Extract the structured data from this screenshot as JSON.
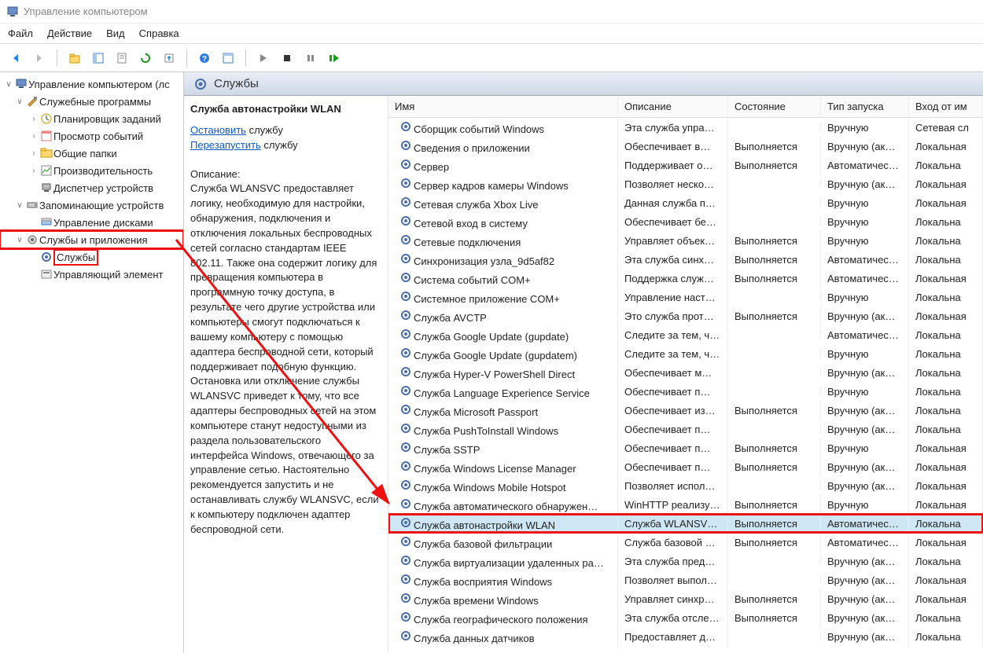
{
  "window": {
    "title": "Управление компьютером"
  },
  "menu": [
    "Файл",
    "Действие",
    "Вид",
    "Справка"
  ],
  "tree": {
    "root": "Управление компьютером (лс",
    "system_tools": "Служебные программы",
    "task_scheduler": "Планировщик заданий",
    "event_viewer": "Просмотр событий",
    "shared_folders": "Общие папки",
    "performance": "Производительность",
    "device_manager": "Диспетчер устройств",
    "storage": "Запоминающие устройств",
    "disk_mgmt": "Управление дисками",
    "services_apps": "Службы и приложения",
    "services": "Службы",
    "wmi": "Управляющий элемент"
  },
  "header": {
    "title": "Службы"
  },
  "detail": {
    "title": "Служба автонастройки WLAN",
    "stop": "Остановить",
    "restart": "Перезапустить",
    "service_suffix": " службу",
    "desc_label": "Описание:",
    "desc_text": "Служба WLANSVC предоставляет логику, необходимую для настройки, обнаружения, подключения и отключения локальных беспроводных сетей согласно стандартам IEEE 802.11. Также она содержит логику для превращения компьютера в программную точку доступа, в результате чего другие устройства или компьютеры смогут подключаться к вашему компьютеру с помощью адаптера беспроводной сети, который поддерживает подобную функцию. Остановка или отключение службы WLANSVC приведет к тому, что все адаптеры беспроводных сетей на этом компьютере станут недоступными из раздела пользовательского интерфейса Windows, отвечающего за управление сетью. Настоятельно рекомендуется запустить и не останавливать службу WLANSVC, если к компьютеру подключен адаптер беспроводной сети."
  },
  "columns": {
    "name": "Имя",
    "desc": "Описание",
    "state": "Состояние",
    "startup": "Тип запуска",
    "logon": "Вход от им"
  },
  "rows": [
    {
      "name": "Сборщик событий Windows",
      "desc": "Эта служба упра…",
      "state": "",
      "startup": "Вручную",
      "logon": "Сетевая сл"
    },
    {
      "name": "Сведения о приложении",
      "desc": "Обеспечивает в…",
      "state": "Выполняется",
      "startup": "Вручную (ак…",
      "logon": "Локальная"
    },
    {
      "name": "Сервер",
      "desc": "Поддерживает о…",
      "state": "Выполняется",
      "startup": "Автоматичес…",
      "logon": "Локальна"
    },
    {
      "name": "Сервер кадров камеры Windows",
      "desc": "Позволяет неско…",
      "state": "",
      "startup": "Вручную (ак…",
      "logon": "Локальная"
    },
    {
      "name": "Сетевая служба Xbox Live",
      "desc": "Данная служба п…",
      "state": "",
      "startup": "Вручную",
      "logon": "Локальная"
    },
    {
      "name": "Сетевой вход в систему",
      "desc": "Обеспечивает бе…",
      "state": "",
      "startup": "Вручную",
      "logon": "Локальна"
    },
    {
      "name": "Сетевые подключения",
      "desc": "Управляет объек…",
      "state": "Выполняется",
      "startup": "Вручную",
      "logon": "Локальна"
    },
    {
      "name": "Синхронизация узла_9d5af82",
      "desc": "Эта служба синх…",
      "state": "Выполняется",
      "startup": "Автоматичес…",
      "logon": "Локальна"
    },
    {
      "name": "Система событий COM+",
      "desc": "Поддержка служ…",
      "state": "Выполняется",
      "startup": "Автоматичес…",
      "logon": "Локальная"
    },
    {
      "name": "Системное приложение COM+",
      "desc": "Управление наст…",
      "state": "",
      "startup": "Вручную",
      "logon": "Локальна"
    },
    {
      "name": "Служба AVCTP",
      "desc": "Это служба прот…",
      "state": "Выполняется",
      "startup": "Вручную (ак…",
      "logon": "Локальная"
    },
    {
      "name": "Служба Google Update (gupdate)",
      "desc": "Следите за тем, ч…",
      "state": "",
      "startup": "Автоматичес…",
      "logon": "Локальна"
    },
    {
      "name": "Служба Google Update (gupdatem)",
      "desc": "Следите за тем, ч…",
      "state": "",
      "startup": "Вручную",
      "logon": "Локальна"
    },
    {
      "name": "Служба Hyper-V PowerShell Direct",
      "desc": "Обеспечивает м…",
      "state": "",
      "startup": "Вручную (ак…",
      "logon": "Локальна"
    },
    {
      "name": "Служба Language Experience Service",
      "desc": "Обеспечивает п…",
      "state": "",
      "startup": "Вручную",
      "logon": "Локальна"
    },
    {
      "name": "Служба Microsoft Passport",
      "desc": "Обеспечивает из…",
      "state": "Выполняется",
      "startup": "Вручную (ак…",
      "logon": "Локальна"
    },
    {
      "name": "Служба PushToInstall Windows",
      "desc": "Обеспечивает п…",
      "state": "",
      "startup": "Вручную (ак…",
      "logon": "Локальна"
    },
    {
      "name": "Служба SSTP",
      "desc": "Обеспечивает п…",
      "state": "Выполняется",
      "startup": "Вручную",
      "logon": "Локальная"
    },
    {
      "name": "Служба Windows License Manager",
      "desc": "Обеспечивает п…",
      "state": "Выполняется",
      "startup": "Вручную (ак…",
      "logon": "Локальная"
    },
    {
      "name": "Служба Windows Mobile Hotspot",
      "desc": "Позволяет испол…",
      "state": "",
      "startup": "Вручную (ак…",
      "logon": "Локальная"
    },
    {
      "name": "Служба автоматического обнаружен…",
      "desc": "WinHTTP реализу…",
      "state": "Выполняется",
      "startup": "Вручную",
      "logon": "Локальная"
    },
    {
      "name": "Служба автонастройки WLAN",
      "desc": "Служба WLANSV…",
      "state": "Выполняется",
      "startup": "Автоматичес…",
      "logon": "Локальна",
      "selected": true
    },
    {
      "name": "Служба базовой фильтрации",
      "desc": "Служба базовой …",
      "state": "Выполняется",
      "startup": "Автоматичес…",
      "logon": "Локальная"
    },
    {
      "name": "Служба виртуализации удаленных ра…",
      "desc": "Эта служба пред…",
      "state": "",
      "startup": "Вручную (ак…",
      "logon": "Локальна"
    },
    {
      "name": "Служба восприятия Windows",
      "desc": "Позволяет выпол…",
      "state": "",
      "startup": "Вручную (ак…",
      "logon": "Локальная"
    },
    {
      "name": "Служба времени Windows",
      "desc": "Управляет синхр…",
      "state": "Выполняется",
      "startup": "Вручную (ак…",
      "logon": "Локальная"
    },
    {
      "name": "Служба географического положения",
      "desc": "Эта служба отсле…",
      "state": "Выполняется",
      "startup": "Вручную (ак…",
      "logon": "Локальна"
    },
    {
      "name": "Служба данных датчиков",
      "desc": "Предоставляет д…",
      "state": "",
      "startup": "Вручную (ак…",
      "logon": "Локальна"
    }
  ]
}
